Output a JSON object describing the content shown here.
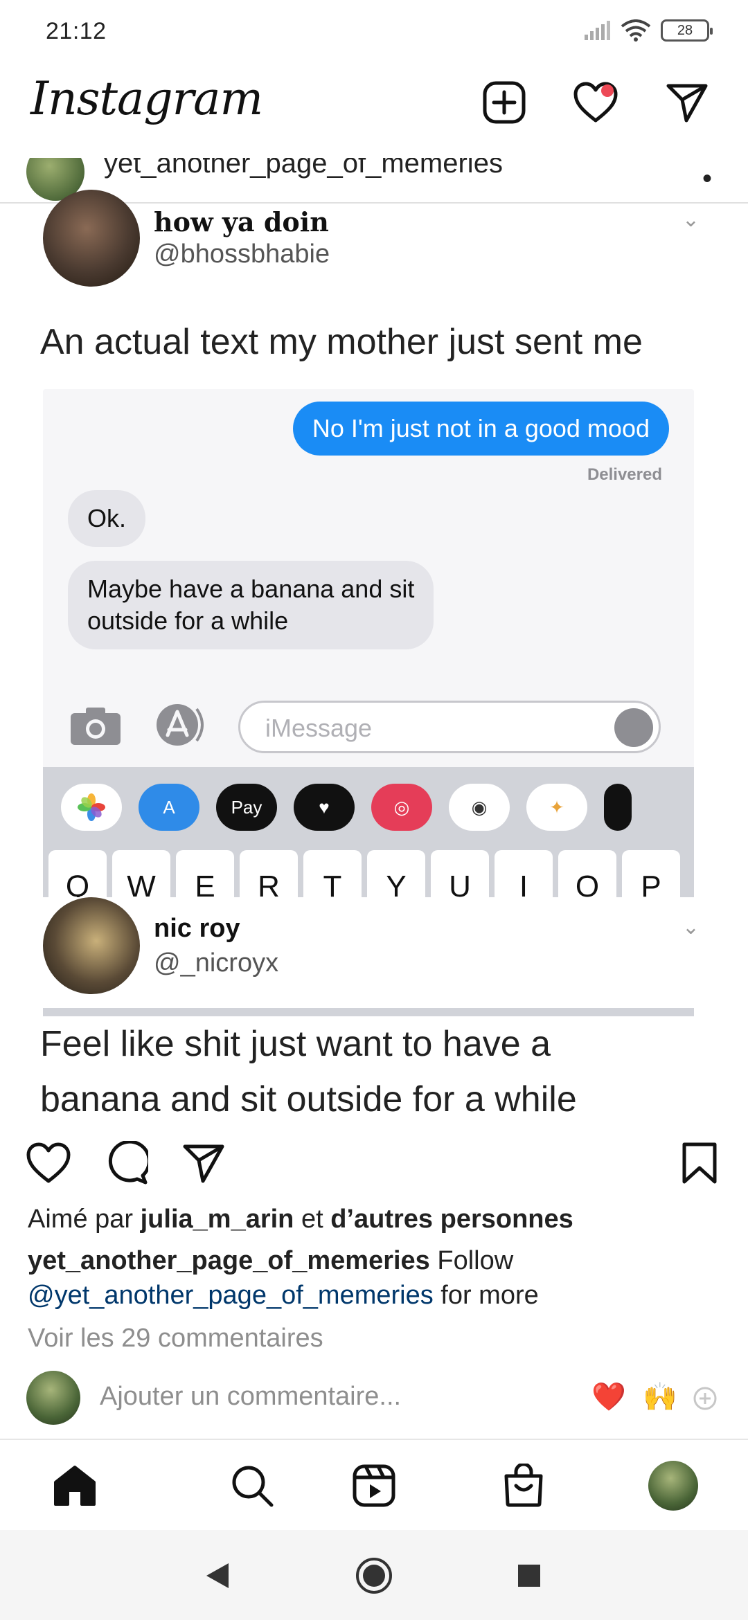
{
  "status_bar": {
    "time": "21:12",
    "battery": "28"
  },
  "header": {
    "logo": "Instagram"
  },
  "post_image": {
    "repost_account": "yet_another_page_of_memeries",
    "tweet1": {
      "name": "how ya doin",
      "handle": "@bhossbhabie",
      "text": "An actual text my mother just sent me"
    },
    "imessage": {
      "outgoing": "No I'm just not in a good mood",
      "delivered": "Delivered",
      "incoming_1": "Ok.",
      "incoming_2_line1": "Maybe have a banana and sit",
      "incoming_2_line2": "outside for a while",
      "placeholder": "iMessage",
      "apple_pay_label": "Pay",
      "keys": [
        "Q",
        "W",
        "E",
        "R",
        "T",
        "Y",
        "U",
        "I",
        "O",
        "P"
      ]
    },
    "tweet2": {
      "name": "nic roy",
      "handle": "@_nicroyx",
      "text_line1": "Feel like shit just want to have a",
      "text_line2": "banana and sit outside for a while"
    }
  },
  "likes": {
    "prefix": "Aimé par",
    "user": "julia_m_arin",
    "connector": "et",
    "others": "d’autres personnes"
  },
  "caption": {
    "username": "yet_another_page_of_memeries",
    "text1": "Follow",
    "mention": "@yet_another_page_of_memeries",
    "text2": "for more"
  },
  "comments_link": "Voir les 29 commentaires",
  "add_comment": {
    "placeholder": "Ajouter un commentaire...",
    "emoji_1": "❤️",
    "emoji_2": "🙌"
  },
  "colors": {
    "notification": "#ed4956",
    "link": "#00376b",
    "imessage_blue": "#1a8cf5"
  }
}
